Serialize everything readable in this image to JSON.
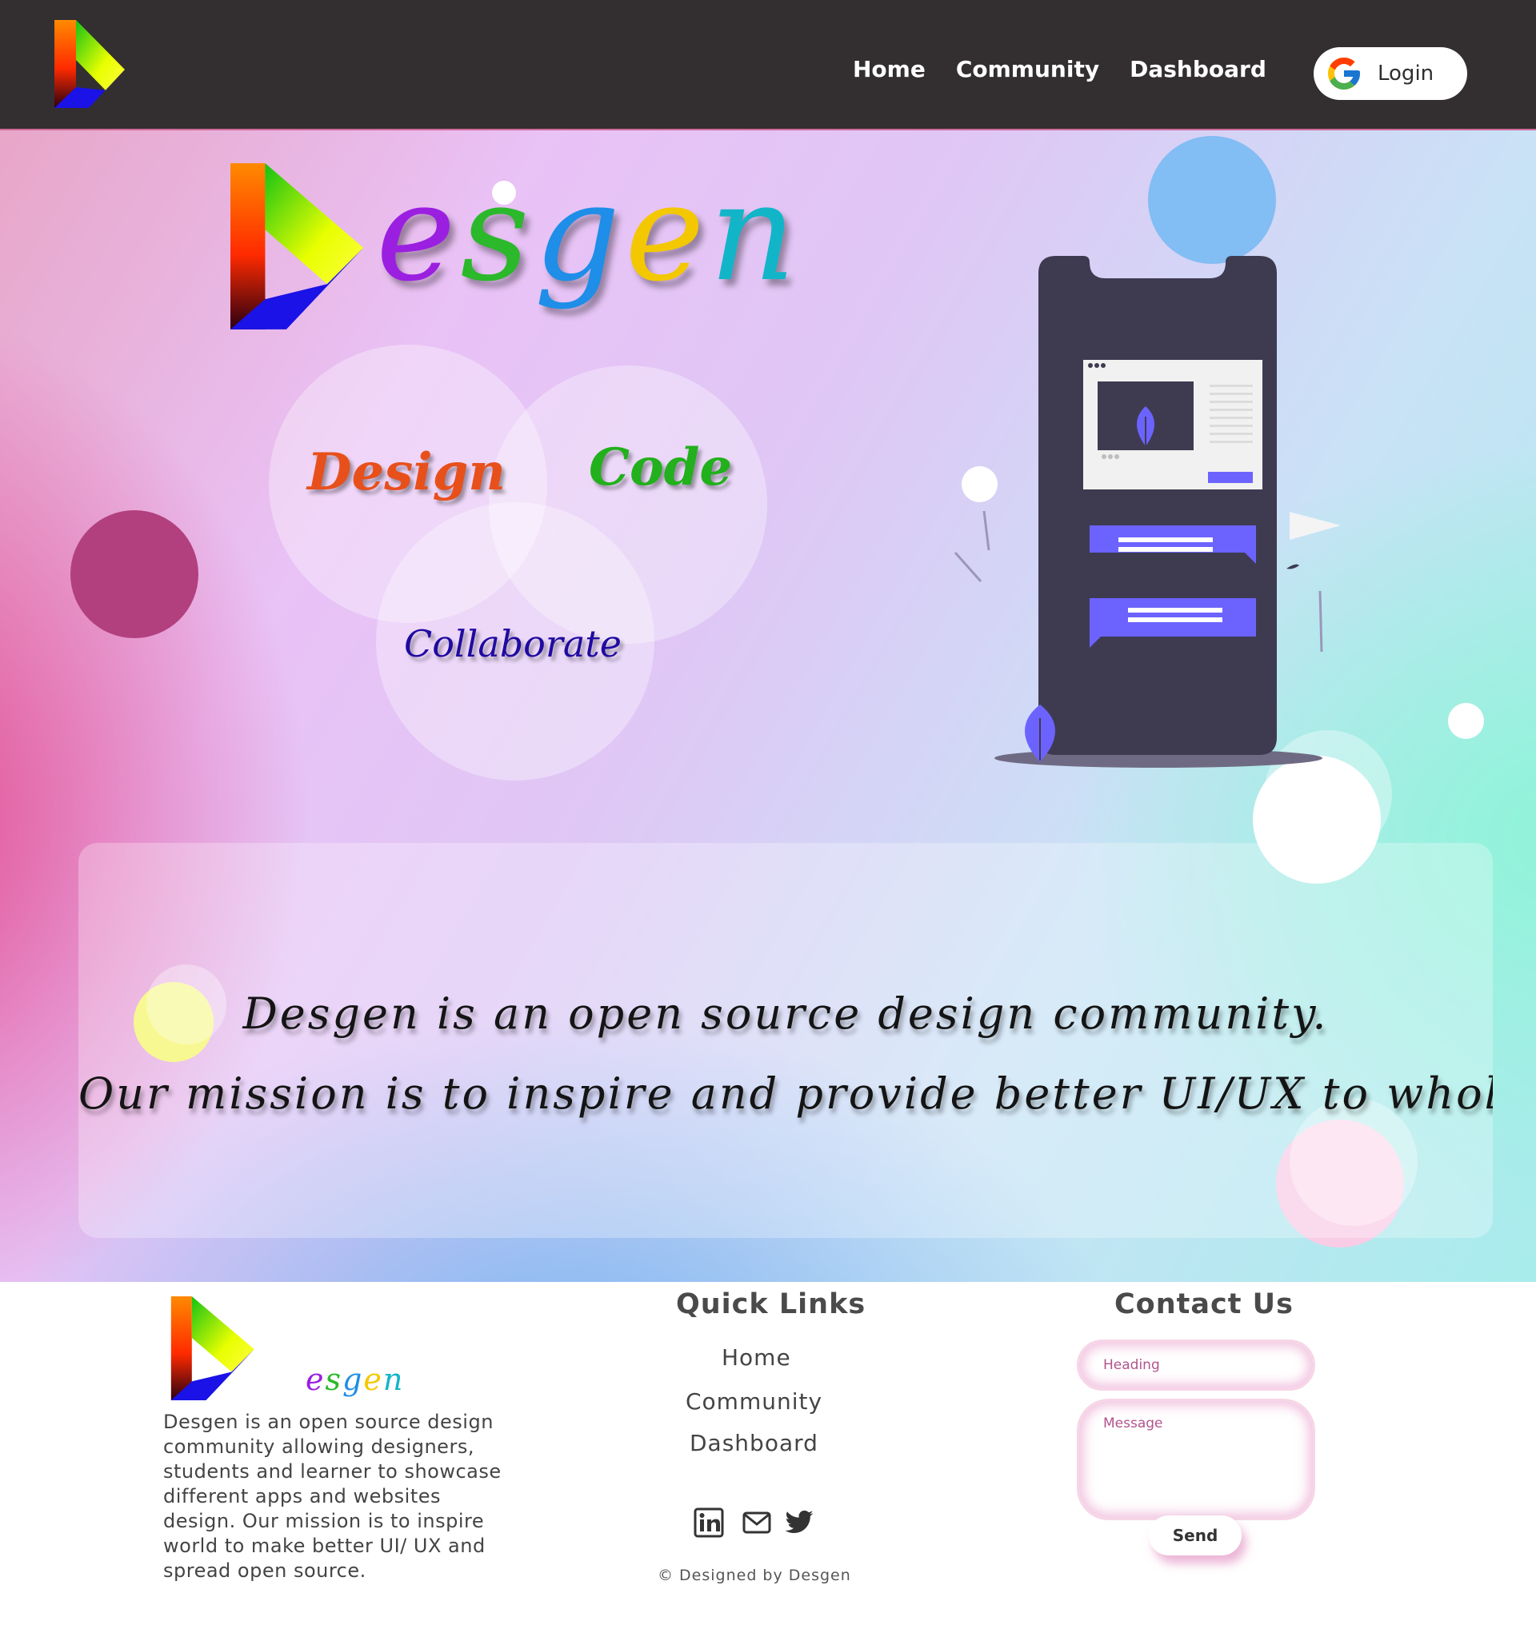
{
  "header": {
    "logo_icon": "desgen-play-logo-icon",
    "nav": [
      {
        "label": "Home"
      },
      {
        "label": "Community"
      },
      {
        "label": "Dashboard"
      }
    ],
    "login": {
      "label": "Login",
      "icon": "google-icon"
    }
  },
  "hero": {
    "wordmark": "esgen",
    "venn": {
      "design": "Design",
      "code": "Code",
      "collaborate": "Collaborate"
    },
    "colors": {
      "design": "#e8501b",
      "code": "#22b01c",
      "collaborate": "#1f0aa0"
    },
    "mission": {
      "line1": "Desgen is an open source design community.",
      "line2": "Our mission is to inspire and provide better UI/UX to whole world."
    }
  },
  "footer": {
    "wordmark": "esgen",
    "about": "Desgen is an open source design community allowing designers, students and learner to showcase different apps and websites design. Our mission is to inspire world to make better UI/ UX and spread open source.",
    "quick_links": {
      "title": "Quick Links",
      "items": [
        {
          "label": "Home"
        },
        {
          "label": "Community"
        },
        {
          "label": "Dashboard"
        }
      ]
    },
    "social": [
      "linkedin-icon",
      "mail-icon",
      "twitter-icon"
    ],
    "copyright": "© Designed by Desgen",
    "contact": {
      "title": "Contact Us",
      "heading_placeholder": "Heading",
      "message_placeholder": "Message",
      "send_label": "Send"
    }
  }
}
